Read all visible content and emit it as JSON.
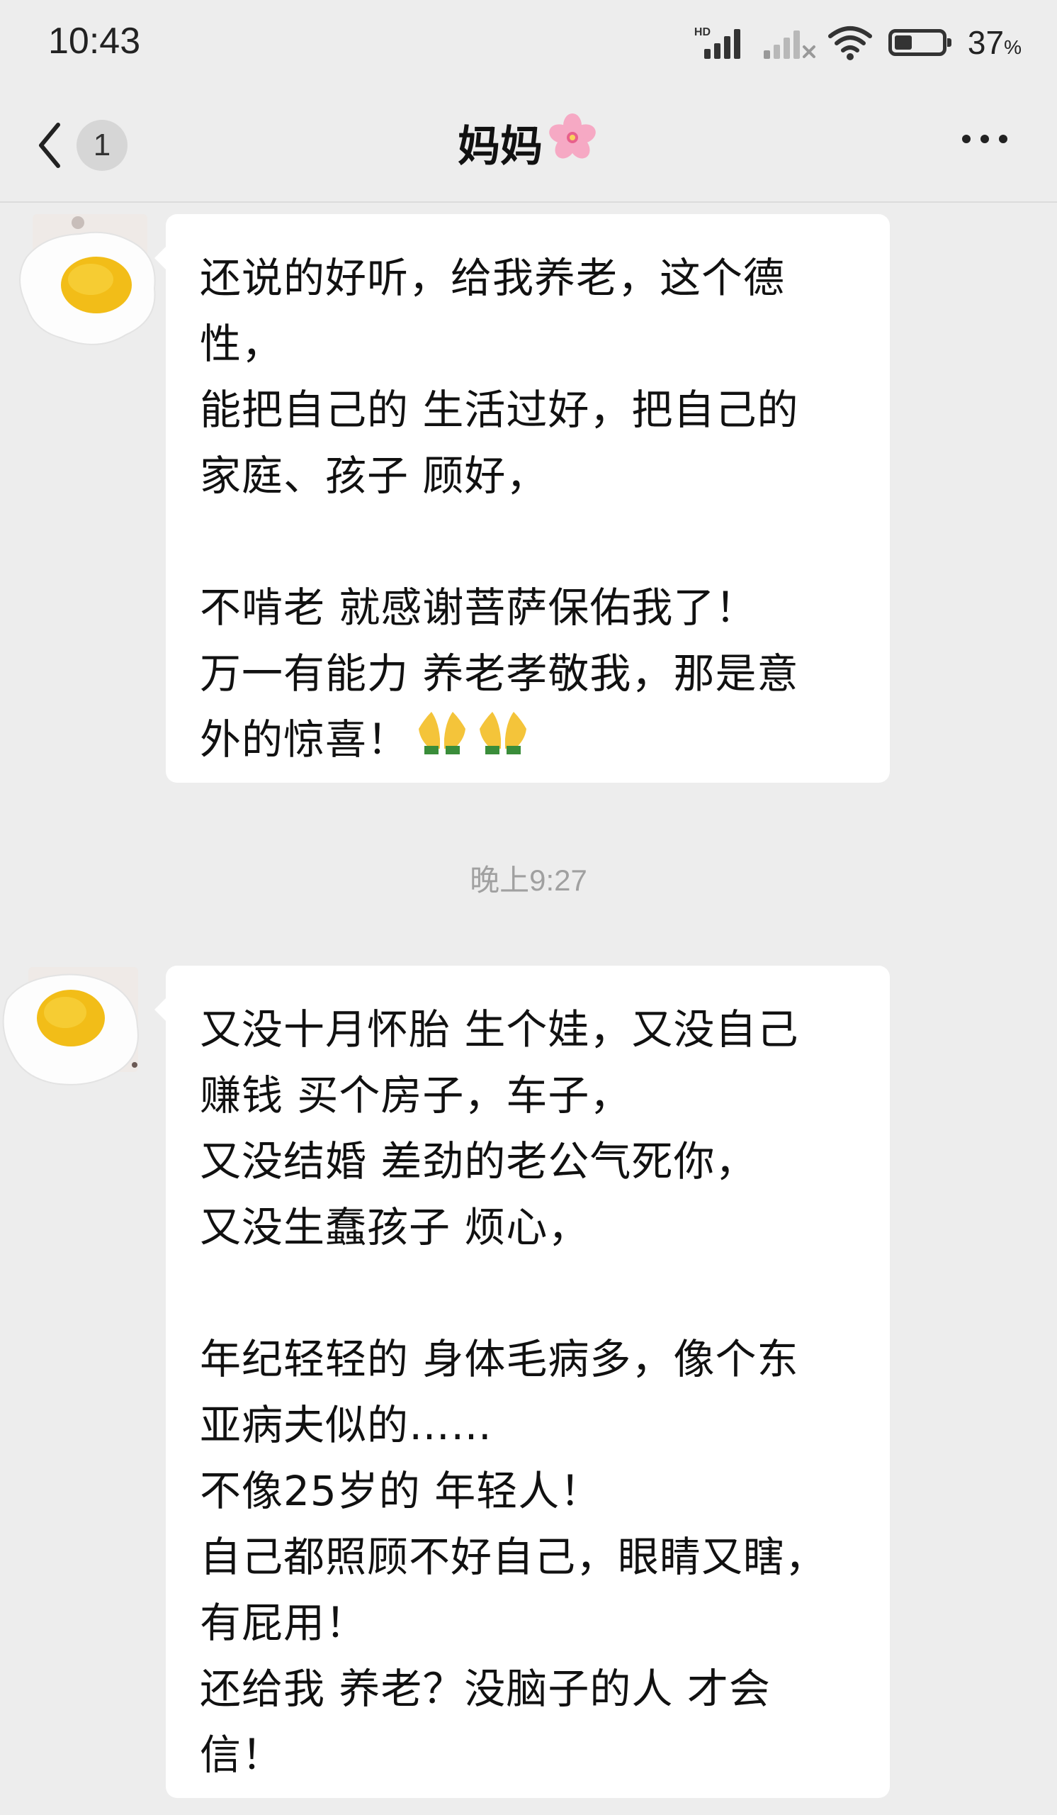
{
  "status_bar": {
    "time": "10:43",
    "signal1_label": "HD",
    "battery_percent": "37",
    "battery_unit": "%",
    "battery_level": 0.37
  },
  "header": {
    "back_icon": "chevron-left-icon",
    "unread_count": "1",
    "title": "妈妈",
    "title_emoji": "cherry-blossom",
    "more_icon": "more-dots-icon"
  },
  "messages": [
    {
      "sender": "妈妈",
      "avatar": "fried-egg-avatar",
      "lines": [
        "还说的好听，给我养老，这个德",
        "性，",
        "能把自己的 生活过好，把自己的",
        "家庭、孩子 顾好，",
        "",
        "不啃老 就感谢菩萨保佑我了！",
        "万一有能力 养老孝敬我，那是意",
        "外的惊喜！"
      ],
      "trailing_emoji": [
        "folded-hands",
        "folded-hands"
      ]
    },
    {
      "sender": "妈妈",
      "avatar": "fried-egg-avatar",
      "lines": [
        "又没十月怀胎 生个娃，又没自己",
        "赚钱 买个房子，车子，",
        "又没结婚 差劲的老公气死你，",
        "又没生蠢孩子 烦心，",
        "",
        "年纪轻轻的 身体毛病多，像个东",
        "亚病夫似的……",
        "不像25岁的 年轻人！",
        "自己都照顾不好自己，眼睛又瞎，",
        "有屁用！",
        "还给我 养老？没脑子的人 才会",
        "信！"
      ]
    }
  ],
  "timestamp": "晚上9:27"
}
